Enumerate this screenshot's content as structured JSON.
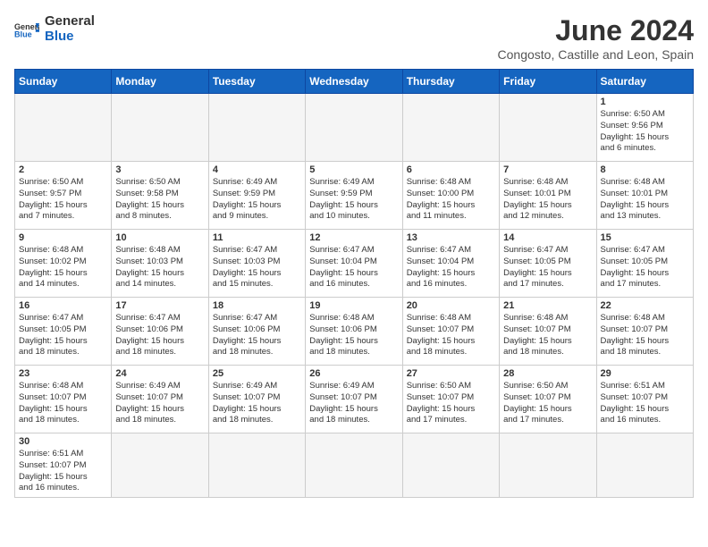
{
  "header": {
    "logo_general": "General",
    "logo_blue": "Blue",
    "month_title": "June 2024",
    "subtitle": "Congosto, Castille and Leon, Spain"
  },
  "days_of_week": [
    "Sunday",
    "Monday",
    "Tuesday",
    "Wednesday",
    "Thursday",
    "Friday",
    "Saturday"
  ],
  "weeks": [
    [
      {
        "day": "",
        "info": ""
      },
      {
        "day": "",
        "info": ""
      },
      {
        "day": "",
        "info": ""
      },
      {
        "day": "",
        "info": ""
      },
      {
        "day": "",
        "info": ""
      },
      {
        "day": "",
        "info": ""
      },
      {
        "day": "1",
        "info": "Sunrise: 6:50 AM\nSunset: 9:56 PM\nDaylight: 15 hours\nand 6 minutes."
      }
    ],
    [
      {
        "day": "2",
        "info": "Sunrise: 6:50 AM\nSunset: 9:57 PM\nDaylight: 15 hours\nand 7 minutes."
      },
      {
        "day": "3",
        "info": "Sunrise: 6:50 AM\nSunset: 9:58 PM\nDaylight: 15 hours\nand 8 minutes."
      },
      {
        "day": "4",
        "info": "Sunrise: 6:49 AM\nSunset: 9:59 PM\nDaylight: 15 hours\nand 9 minutes."
      },
      {
        "day": "5",
        "info": "Sunrise: 6:49 AM\nSunset: 9:59 PM\nDaylight: 15 hours\nand 10 minutes."
      },
      {
        "day": "6",
        "info": "Sunrise: 6:48 AM\nSunset: 10:00 PM\nDaylight: 15 hours\nand 11 minutes."
      },
      {
        "day": "7",
        "info": "Sunrise: 6:48 AM\nSunset: 10:01 PM\nDaylight: 15 hours\nand 12 minutes."
      },
      {
        "day": "8",
        "info": "Sunrise: 6:48 AM\nSunset: 10:01 PM\nDaylight: 15 hours\nand 13 minutes."
      }
    ],
    [
      {
        "day": "9",
        "info": "Sunrise: 6:48 AM\nSunset: 10:02 PM\nDaylight: 15 hours\nand 14 minutes."
      },
      {
        "day": "10",
        "info": "Sunrise: 6:48 AM\nSunset: 10:03 PM\nDaylight: 15 hours\nand 14 minutes."
      },
      {
        "day": "11",
        "info": "Sunrise: 6:47 AM\nSunset: 10:03 PM\nDaylight: 15 hours\nand 15 minutes."
      },
      {
        "day": "12",
        "info": "Sunrise: 6:47 AM\nSunset: 10:04 PM\nDaylight: 15 hours\nand 16 minutes."
      },
      {
        "day": "13",
        "info": "Sunrise: 6:47 AM\nSunset: 10:04 PM\nDaylight: 15 hours\nand 16 minutes."
      },
      {
        "day": "14",
        "info": "Sunrise: 6:47 AM\nSunset: 10:05 PM\nDaylight: 15 hours\nand 17 minutes."
      },
      {
        "day": "15",
        "info": "Sunrise: 6:47 AM\nSunset: 10:05 PM\nDaylight: 15 hours\nand 17 minutes."
      }
    ],
    [
      {
        "day": "16",
        "info": "Sunrise: 6:47 AM\nSunset: 10:05 PM\nDaylight: 15 hours\nand 18 minutes."
      },
      {
        "day": "17",
        "info": "Sunrise: 6:47 AM\nSunset: 10:06 PM\nDaylight: 15 hours\nand 18 minutes."
      },
      {
        "day": "18",
        "info": "Sunrise: 6:47 AM\nSunset: 10:06 PM\nDaylight: 15 hours\nand 18 minutes."
      },
      {
        "day": "19",
        "info": "Sunrise: 6:48 AM\nSunset: 10:06 PM\nDaylight: 15 hours\nand 18 minutes."
      },
      {
        "day": "20",
        "info": "Sunrise: 6:48 AM\nSunset: 10:07 PM\nDaylight: 15 hours\nand 18 minutes."
      },
      {
        "day": "21",
        "info": "Sunrise: 6:48 AM\nSunset: 10:07 PM\nDaylight: 15 hours\nand 18 minutes."
      },
      {
        "day": "22",
        "info": "Sunrise: 6:48 AM\nSunset: 10:07 PM\nDaylight: 15 hours\nand 18 minutes."
      }
    ],
    [
      {
        "day": "23",
        "info": "Sunrise: 6:48 AM\nSunset: 10:07 PM\nDaylight: 15 hours\nand 18 minutes."
      },
      {
        "day": "24",
        "info": "Sunrise: 6:49 AM\nSunset: 10:07 PM\nDaylight: 15 hours\nand 18 minutes."
      },
      {
        "day": "25",
        "info": "Sunrise: 6:49 AM\nSunset: 10:07 PM\nDaylight: 15 hours\nand 18 minutes."
      },
      {
        "day": "26",
        "info": "Sunrise: 6:49 AM\nSunset: 10:07 PM\nDaylight: 15 hours\nand 18 minutes."
      },
      {
        "day": "27",
        "info": "Sunrise: 6:50 AM\nSunset: 10:07 PM\nDaylight: 15 hours\nand 17 minutes."
      },
      {
        "day": "28",
        "info": "Sunrise: 6:50 AM\nSunset: 10:07 PM\nDaylight: 15 hours\nand 17 minutes."
      },
      {
        "day": "29",
        "info": "Sunrise: 6:51 AM\nSunset: 10:07 PM\nDaylight: 15 hours\nand 16 minutes."
      }
    ],
    [
      {
        "day": "30",
        "info": "Sunrise: 6:51 AM\nSunset: 10:07 PM\nDaylight: 15 hours\nand 16 minutes."
      },
      {
        "day": "",
        "info": ""
      },
      {
        "day": "",
        "info": ""
      },
      {
        "day": "",
        "info": ""
      },
      {
        "day": "",
        "info": ""
      },
      {
        "day": "",
        "info": ""
      },
      {
        "day": "",
        "info": ""
      }
    ]
  ]
}
